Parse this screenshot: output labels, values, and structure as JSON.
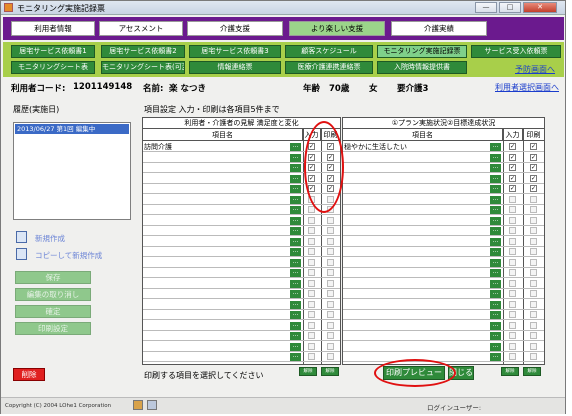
{
  "window": {
    "title": "モニタリング実施記録票",
    "min": "—",
    "max": "□",
    "close": "✕"
  },
  "nav1": [
    {
      "label": "利用者情報",
      "active": false
    },
    {
      "label": "アセスメント",
      "active": false
    },
    {
      "label": "介護支援",
      "active": false
    },
    {
      "label": "より楽しい支援",
      "active": true
    },
    {
      "label": "介護実績",
      "active": false
    }
  ],
  "nav2": {
    "row1": [
      "居宅サービス依頼書1",
      "居宅サービス依頼書2",
      "居宅サービス依頼書3",
      "顧客スケジュール",
      "モニタリング実施記録票",
      "サービス受入依頼票"
    ],
    "row2": [
      "モニタリングシート表",
      "モニタリングシート表(可変)",
      "情報連絡票",
      "医療介護連携連絡票",
      "入院時情報提供書"
    ],
    "active": "モニタリング実施記録票",
    "links": {
      "schedule": "予防画面へ",
      "user_select": "利用者選択画面へ"
    }
  },
  "info": {
    "user_code_label": "利用者コード:",
    "user_code": "1201149148",
    "name_label": "名前:",
    "name": "楽 なつき",
    "age_label": "年齢",
    "age": "70歳",
    "sex": "女",
    "care_level": "要介護3"
  },
  "left": {
    "history_label": "履歴(実施日)",
    "history_items": [
      "2013/06/27 第1回 編集中"
    ],
    "new_create": "新規作成",
    "copy_create": "コピーして新規作成",
    "save": "保存",
    "cancel_edit": "編集の取り消し",
    "confirm": "確定",
    "print_settings": "印刷設定",
    "delete": "削除"
  },
  "item_setting": "項目設定 入力・印刷は各項目5件まで",
  "tableL": {
    "header": "利用者・介護者の見解 満足度と変化",
    "col_item": "項目名",
    "col_input": "入力",
    "col_print": "印刷",
    "rows": [
      {
        "text": "訪問介護",
        "input": true,
        "print": true
      },
      {
        "text": "",
        "input": true,
        "print": true
      },
      {
        "text": "",
        "input": true,
        "print": true
      },
      {
        "text": "",
        "input": true,
        "print": true
      },
      {
        "text": "",
        "input": true,
        "print": true
      },
      {
        "text": "",
        "input": false,
        "print": false
      },
      {
        "text": "",
        "input": false,
        "print": false
      },
      {
        "text": "",
        "input": false,
        "print": false
      },
      {
        "text": "",
        "input": false,
        "print": false
      },
      {
        "text": "",
        "input": false,
        "print": false
      },
      {
        "text": "",
        "input": false,
        "print": false
      },
      {
        "text": "",
        "input": false,
        "print": false
      },
      {
        "text": "",
        "input": false,
        "print": false
      },
      {
        "text": "",
        "input": false,
        "print": false
      },
      {
        "text": "",
        "input": false,
        "print": false
      },
      {
        "text": "",
        "input": false,
        "print": false
      },
      {
        "text": "",
        "input": false,
        "print": false
      },
      {
        "text": "",
        "input": false,
        "print": false
      },
      {
        "text": "",
        "input": false,
        "print": false
      },
      {
        "text": "",
        "input": false,
        "print": false
      },
      {
        "text": "",
        "input": false,
        "print": false
      }
    ]
  },
  "tableR": {
    "header": "①プラン実施状況②目標達成状況",
    "col_item": "項目名",
    "col_input": "入力",
    "col_print": "印刷",
    "rows": [
      {
        "text": "穏やかに生活したい",
        "input": true,
        "print": true
      },
      {
        "text": "",
        "input": true,
        "print": true
      },
      {
        "text": "",
        "input": true,
        "print": true
      },
      {
        "text": "",
        "input": true,
        "print": true
      },
      {
        "text": "",
        "input": true,
        "print": true
      },
      {
        "text": "",
        "input": false,
        "print": false
      },
      {
        "text": "",
        "input": false,
        "print": false
      },
      {
        "text": "",
        "input": false,
        "print": false
      },
      {
        "text": "",
        "input": false,
        "print": false
      },
      {
        "text": "",
        "input": false,
        "print": false
      },
      {
        "text": "",
        "input": false,
        "print": false
      },
      {
        "text": "",
        "input": false,
        "print": false
      },
      {
        "text": "",
        "input": false,
        "print": false
      },
      {
        "text": "",
        "input": false,
        "print": false
      },
      {
        "text": "",
        "input": false,
        "print": false
      },
      {
        "text": "",
        "input": false,
        "print": false
      },
      {
        "text": "",
        "input": false,
        "print": false
      },
      {
        "text": "",
        "input": false,
        "print": false
      },
      {
        "text": "",
        "input": false,
        "print": false
      },
      {
        "text": "",
        "input": false,
        "print": false
      },
      {
        "text": "",
        "input": false,
        "print": false
      }
    ]
  },
  "clear_buttons": "解除",
  "bottom": {
    "message": "印刷する項目を選択してください",
    "preview": "印刷プレビュー",
    "close": "閉じる",
    "copyright": "Copyright (C) 2004 LOhe1 Corporation",
    "login_user": "ログインユーザー:"
  },
  "colors": {
    "purple": "#6b1a8e",
    "green_bar": "#a8cf4a",
    "button_green": "#2f8a3a",
    "highlight_red": "#e01010"
  }
}
